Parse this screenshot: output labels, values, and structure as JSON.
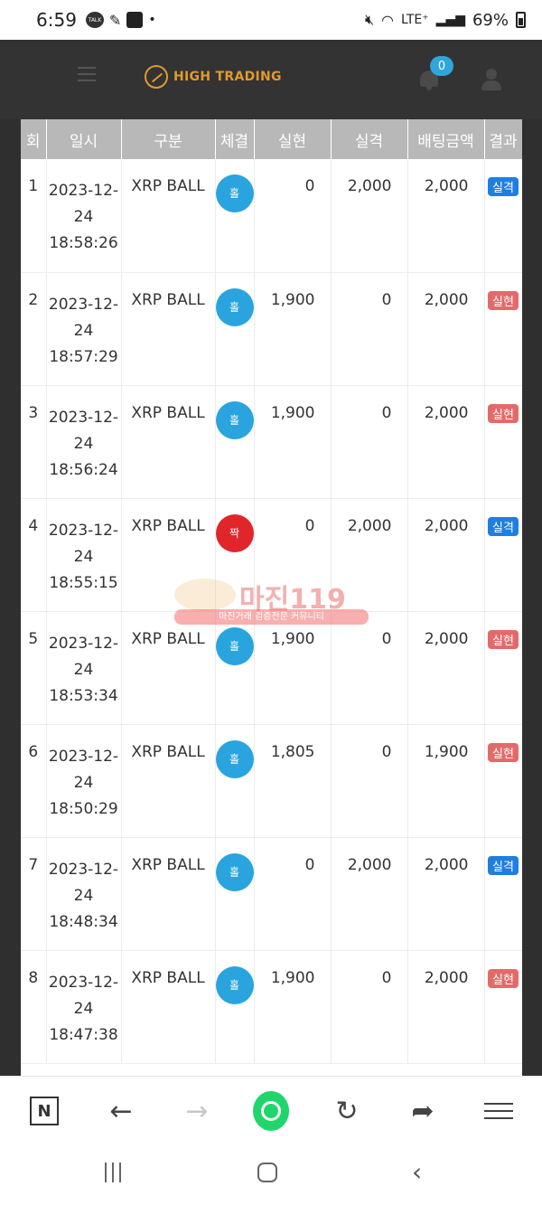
{
  "status_bar": {
    "time": "6:59",
    "network": "LTE⁺",
    "battery": "69%",
    "icons": [
      "talk-icon",
      "pen-icon",
      "puzzle-icon",
      "mute-icon",
      "wifi-icon",
      "signal-icon",
      "battery-icon"
    ]
  },
  "header": {
    "brand": "HIGH TRADING",
    "notification_count": "0"
  },
  "table": {
    "columns": [
      "회",
      "일시",
      "구분",
      "체결",
      "실현",
      "실격",
      "배팅금액",
      "결과"
    ],
    "rows": [
      {
        "no": "1",
        "date": "2023-12-",
        "date2": "24",
        "time": "18:58:26",
        "category": "XRP BALL",
        "result": "홀",
        "result_type": "odd",
        "realized": "0",
        "lost": "2,000",
        "bet": "2,000",
        "outcome": "실격",
        "outcome_type": "loss"
      },
      {
        "no": "2",
        "date": "2023-12-",
        "date2": "24",
        "time": "18:57:29",
        "category": "XRP BALL",
        "result": "홀",
        "result_type": "odd",
        "realized": "1,900",
        "lost": "0",
        "bet": "2,000",
        "outcome": "실현",
        "outcome_type": "win"
      },
      {
        "no": "3",
        "date": "2023-12-",
        "date2": "24",
        "time": "18:56:24",
        "category": "XRP BALL",
        "result": "홀",
        "result_type": "odd",
        "realized": "1,900",
        "lost": "0",
        "bet": "2,000",
        "outcome": "실현",
        "outcome_type": "win"
      },
      {
        "no": "4",
        "date": "2023-12-",
        "date2": "24",
        "time": "18:55:15",
        "category": "XRP BALL",
        "result": "짝",
        "result_type": "even",
        "realized": "0",
        "lost": "2,000",
        "bet": "2,000",
        "outcome": "실격",
        "outcome_type": "loss"
      },
      {
        "no": "5",
        "date": "2023-12-",
        "date2": "24",
        "time": "18:53:34",
        "category": "XRP BALL",
        "result": "홀",
        "result_type": "odd",
        "realized": "1,900",
        "lost": "0",
        "bet": "2,000",
        "outcome": "실현",
        "outcome_type": "win"
      },
      {
        "no": "6",
        "date": "2023-12-",
        "date2": "24",
        "time": "18:50:29",
        "category": "XRP BALL",
        "result": "홀",
        "result_type": "odd",
        "realized": "1,805",
        "lost": "0",
        "bet": "1,900",
        "outcome": "실현",
        "outcome_type": "win"
      },
      {
        "no": "7",
        "date": "2023-12-",
        "date2": "24",
        "time": "18:48:34",
        "category": "XRP BALL",
        "result": "홀",
        "result_type": "odd",
        "realized": "0",
        "lost": "2,000",
        "bet": "2,000",
        "outcome": "실격",
        "outcome_type": "loss"
      },
      {
        "no": "8",
        "date": "2023-12-",
        "date2": "24",
        "time": "18:47:38",
        "category": "XRP BALL",
        "result": "홀",
        "result_type": "odd",
        "realized": "1,900",
        "lost": "0",
        "bet": "2,000",
        "outcome": "실현",
        "outcome_type": "win"
      }
    ]
  },
  "watermark": {
    "title": "마진119",
    "subtitle": "마진거래 검증전문 커뮤니티"
  },
  "colors": {
    "odd": "#29a4de",
    "even": "#e0262b",
    "win": "#e46a6a",
    "loss": "#1e7fe0",
    "brand": "#e09a2d"
  }
}
